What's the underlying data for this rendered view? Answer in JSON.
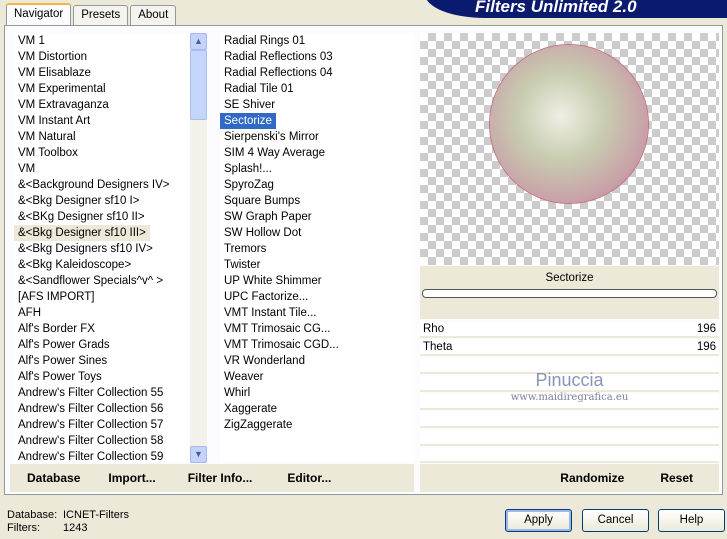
{
  "title": "Filters Unlimited 2.0",
  "tabs": [
    "Navigator",
    "Presets",
    "About"
  ],
  "categories": [
    "VM 1",
    "VM Distortion",
    "VM Elisablaze",
    "VM Experimental",
    "VM Extravaganza",
    "VM Instant Art",
    "VM Natural",
    "VM Toolbox",
    "VM",
    "&<Background Designers IV>",
    "&<Bkg Designer sf10 I>",
    "&<BKg Designer sf10 II>",
    "&<Bkg Designer sf10 III>",
    "&<Bkg Designers sf10 IV>",
    "&<Bkg Kaleidoscope>",
    "&<Sandflower Specials^v^ >",
    "[AFS IMPORT]",
    "AFH",
    "Alf's Border FX",
    "Alf's Power Grads",
    "Alf's Power Sines",
    "Alf's Power Toys",
    "Andrew's Filter Collection 55",
    "Andrew's Filter Collection 56",
    "Andrew's Filter Collection 57",
    "Andrew's Filter Collection 58",
    "Andrew's Filter Collection 59"
  ],
  "selected_category": 12,
  "filters": [
    "Radial  Rings 01",
    "Radial Reflections 03",
    "Radial Reflections 04",
    "Radial Tile 01",
    "SE Shiver",
    "Sectorize",
    "Sierpenski's Mirror",
    "SIM 4 Way Average",
    "Splash!...",
    "SpyroZag",
    "Square Bumps",
    "SW Graph Paper",
    "SW Hollow Dot",
    "Tremors",
    "Twister",
    "UP White Shimmer",
    "UPC Factorize...",
    "VMT Instant Tile...",
    "VMT Trimosaic CG...",
    "VMT Trimosaic CGD...",
    "VR Wonderland",
    "Weaver",
    "Whirl",
    "Xaggerate",
    "ZigZaggerate"
  ],
  "selected_filter": 5,
  "left_buttons": [
    "Database",
    "Import...",
    "Filter Info...",
    "Editor..."
  ],
  "filter_name": "Sectorize",
  "params": [
    {
      "label": "Rho",
      "value": "196"
    },
    {
      "label": "Theta",
      "value": "196"
    }
  ],
  "right_buttons": [
    "Randomize",
    "Reset"
  ],
  "watermark": {
    "name": "Pinuccia",
    "url": "www.maidiregrafica.eu"
  },
  "status": {
    "db_label": "Database:",
    "db_value": "ICNET-Filters",
    "filters_label": "Filters:",
    "filters_value": "1243"
  },
  "dialog_buttons": [
    "Apply",
    "Cancel",
    "Help"
  ]
}
